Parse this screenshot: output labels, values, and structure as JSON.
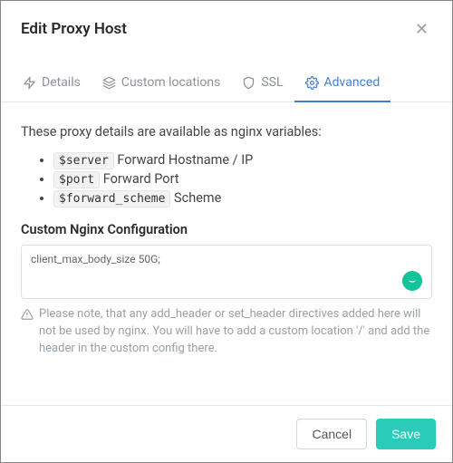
{
  "header": {
    "title": "Edit Proxy Host"
  },
  "tabs": {
    "details": "Details",
    "custom_locations": "Custom locations",
    "ssl": "SSL",
    "advanced": "Advanced"
  },
  "content": {
    "intro": "These proxy details are available as nginx variables:",
    "vars": [
      {
        "code": "$server",
        "desc": "Forward Hostname / IP"
      },
      {
        "code": "$port",
        "desc": "Forward Port"
      },
      {
        "code": "$forward_scheme",
        "desc": "Scheme"
      }
    ],
    "config_label": "Custom Nginx Configuration",
    "config_value": "client_max_body_size 50G;",
    "note": "Please note, that any add_header or set_header directives added here will not be used by nginx. You will have to add a custom location '/' and add the header in the custom config there."
  },
  "footer": {
    "cancel": "Cancel",
    "save": "Save"
  }
}
